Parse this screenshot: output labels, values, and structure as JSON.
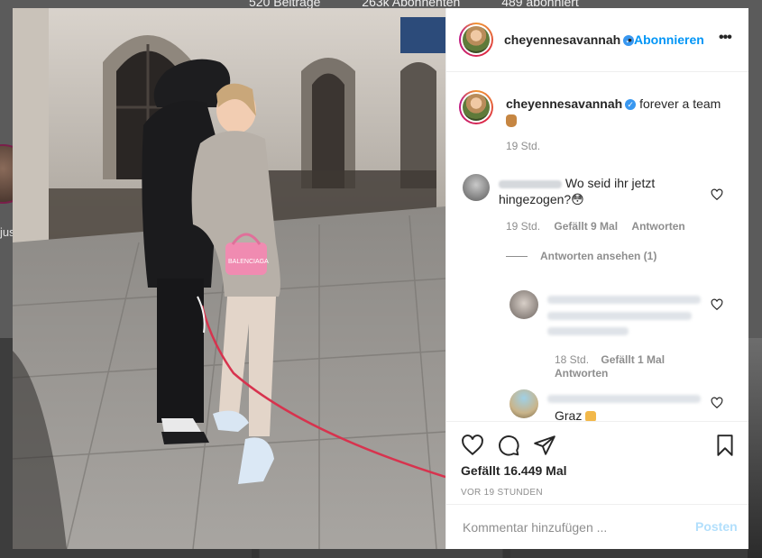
{
  "background": {
    "stats": [
      "520 Beiträge",
      "263k Abonnenten",
      "489 abonniert"
    ],
    "name_fragment": "jus"
  },
  "post": {
    "username": "cheyennesavannah",
    "follow_label": "Abonnieren",
    "separator": "•",
    "more_label": "•••",
    "caption_text": "forever a team",
    "caption_time": "19 Std.",
    "photo_text": "BALENCIAGA"
  },
  "comments": [
    {
      "text": "Wo seid ihr jetzt hingezogen?😳",
      "time": "19 Std.",
      "likes": "Gefällt 9 Mal",
      "reply_label": "Antworten",
      "view_replies": "Antworten ansehen (1)"
    }
  ],
  "replies": [
    {
      "time": "18 Std.",
      "likes": "Gefällt 1 Mal",
      "reply_label": "Antworten"
    },
    {
      "text": "Graz"
    }
  ],
  "actions": {
    "likes": "Gefällt 16.449 Mal",
    "timestamp": "VOR 19 STUNDEN"
  },
  "add_comment": {
    "placeholder": "Kommentar hinzufügen ...",
    "post_label": "Posten"
  },
  "colors": {
    "accent": "#0095f6",
    "verified": "#3897f0",
    "post_disabled": "#b2dffc"
  }
}
